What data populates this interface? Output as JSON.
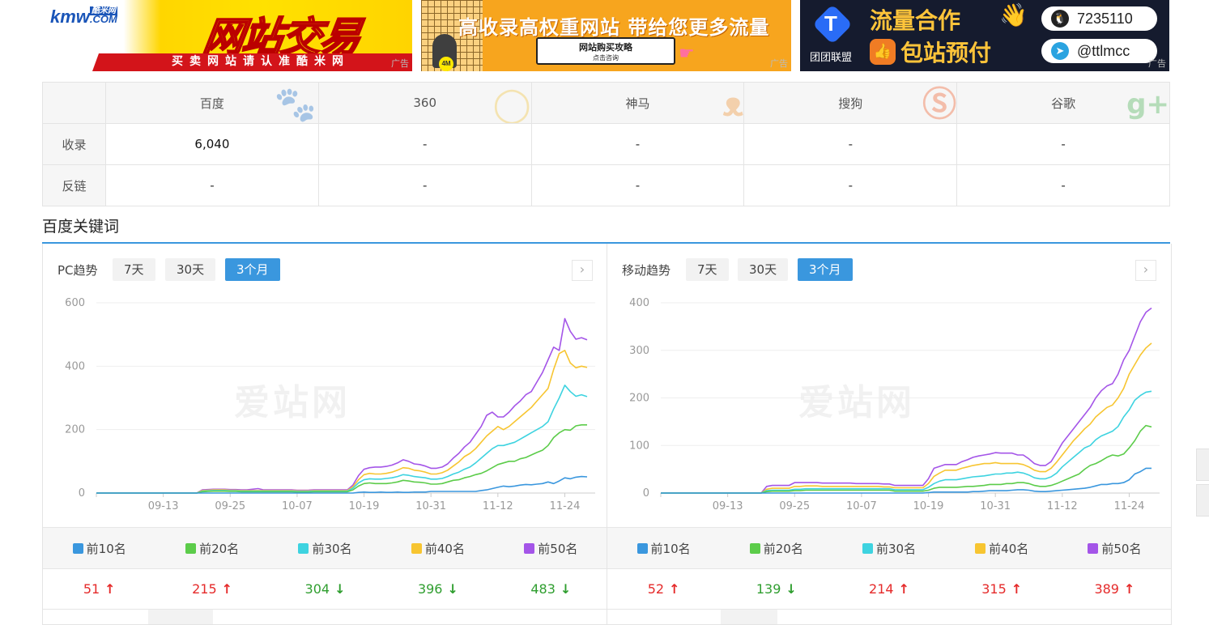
{
  "ads": [
    {
      "logo_main": "kmw",
      "logo_badge": "酷米网",
      "logo_com": ".COM",
      "headline": "网站交易",
      "strip": "买卖网站请认准酷米网",
      "tag": "广告"
    },
    {
      "headline": "高收录高权重网站  带给您更多流量",
      "bubble_line1": "网站购买攻略",
      "bubble_line2": "点击咨询",
      "ball": "4M",
      "tag": "广告"
    },
    {
      "brand": "团团联盟",
      "line1": "流量合作",
      "line2": "包站预付",
      "contact1": "7235110",
      "contact2": "@ttlmcc",
      "tag": "广告"
    }
  ],
  "stats": {
    "engines": [
      {
        "name": "百度",
        "icon": "baidu-paw-icon",
        "color": "#3a7ee8"
      },
      {
        "name": "360",
        "icon": "360-icon",
        "color": "#f1c232"
      },
      {
        "name": "神马",
        "icon": "shenma-icon",
        "color": "#f08a24"
      },
      {
        "name": "搜狗",
        "icon": "sogou-icon",
        "color": "#f0541e"
      },
      {
        "name": "谷歌",
        "icon": "google-plus-icon",
        "color": "#3fae49"
      }
    ],
    "rows": [
      {
        "label": "收录",
        "values": [
          "6,040",
          "-",
          "-",
          "-",
          "-"
        ]
      },
      {
        "label": "反链",
        "values": [
          "-",
          "-",
          "-",
          "-",
          "-"
        ]
      }
    ]
  },
  "section_title": "百度关键词",
  "series_names": [
    "前10名",
    "前20名",
    "前30名",
    "前40名",
    "前50名"
  ],
  "series_colors": [
    "#3a97de",
    "#5ccc4a",
    "#3ed3e0",
    "#f7c531",
    "#a455e8"
  ],
  "panels": {
    "pc": {
      "title": "PC趋势",
      "ranges": [
        "7天",
        "30天",
        "3个月"
      ],
      "active_range": "3个月",
      "next": "›",
      "values": [
        {
          "value": "51",
          "trend": "up"
        },
        {
          "value": "215",
          "trend": "up"
        },
        {
          "value": "304",
          "trend": "down"
        },
        {
          "value": "396",
          "trend": "down"
        },
        {
          "value": "483",
          "trend": "down"
        }
      ]
    },
    "mobile": {
      "title": "移动趋势",
      "ranges": [
        "7天",
        "30天",
        "3个月"
      ],
      "active_range": "3个月",
      "next": "›",
      "values": [
        {
          "value": "52",
          "trend": "up"
        },
        {
          "value": "139",
          "trend": "down"
        },
        {
          "value": "214",
          "trend": "up"
        },
        {
          "value": "315",
          "trend": "up"
        },
        {
          "value": "389",
          "trend": "up"
        }
      ]
    }
  },
  "watermark": "爱站网",
  "chart_data": [
    {
      "type": "line",
      "title": "PC趋势",
      "x_ticks": [
        "09-13",
        "09-25",
        "10-07",
        "10-19",
        "10-31",
        "11-12",
        "11-24"
      ],
      "y_ticks": [
        0,
        200,
        400,
        600
      ],
      "ylim": [
        0,
        600
      ],
      "x_index_ticks": [
        12,
        24,
        36,
        48,
        60,
        72,
        84
      ],
      "n_points": 89,
      "series": [
        {
          "name": "前10名",
          "values": [
            0,
            0,
            0,
            0,
            0,
            0,
            0,
            0,
            0,
            0,
            0,
            0,
            0,
            0,
            0,
            0,
            0,
            0,
            0,
            0,
            0,
            0,
            0,
            0,
            0,
            0,
            0,
            0,
            0,
            0,
            0,
            0,
            0,
            0,
            0,
            0,
            0,
            0,
            0,
            0,
            0,
            0,
            0,
            0,
            0,
            0,
            0,
            2,
            3,
            2,
            2,
            3,
            2,
            2,
            3,
            2,
            2,
            3,
            3,
            3,
            5,
            5,
            5,
            5,
            5,
            5,
            5,
            5,
            5,
            8,
            10,
            14,
            18,
            22,
            20,
            22,
            25,
            27,
            26,
            28,
            30,
            35,
            30,
            38,
            48,
            45,
            50,
            52,
            51
          ]
        },
        {
          "name": "前20名",
          "values": [
            0,
            0,
            0,
            0,
            0,
            0,
            0,
            0,
            0,
            0,
            0,
            0,
            0,
            0,
            0,
            0,
            0,
            0,
            0,
            4,
            5,
            6,
            6,
            6,
            5,
            5,
            4,
            4,
            4,
            4,
            4,
            4,
            4,
            4,
            4,
            4,
            3,
            3,
            3,
            4,
            4,
            4,
            4,
            4,
            4,
            4,
            10,
            22,
            30,
            32,
            30,
            30,
            30,
            32,
            35,
            40,
            38,
            35,
            34,
            32,
            28,
            28,
            30,
            35,
            40,
            42,
            48,
            52,
            58,
            62,
            70,
            80,
            90,
            95,
            100,
            100,
            108,
            112,
            120,
            128,
            135,
            150,
            175,
            190,
            200,
            198,
            212,
            215,
            215
          ]
        },
        {
          "name": "前30名",
          "values": [
            0,
            0,
            0,
            0,
            0,
            0,
            0,
            0,
            0,
            0,
            0,
            0,
            0,
            0,
            0,
            0,
            0,
            0,
            0,
            6,
            7,
            8,
            8,
            8,
            7,
            7,
            6,
            6,
            6,
            6,
            6,
            6,
            6,
            6,
            6,
            6,
            5,
            5,
            5,
            6,
            6,
            6,
            6,
            6,
            6,
            6,
            15,
            32,
            42,
            45,
            44,
            44,
            46,
            48,
            52,
            58,
            56,
            52,
            50,
            48,
            44,
            44,
            46,
            52,
            60,
            66,
            75,
            82,
            95,
            110,
            125,
            140,
            150,
            150,
            155,
            160,
            170,
            180,
            190,
            200,
            210,
            225,
            265,
            300,
            340,
            320,
            305,
            310,
            304
          ]
        },
        {
          "name": "前40名",
          "values": [
            0,
            0,
            0,
            0,
            0,
            0,
            0,
            0,
            0,
            0,
            0,
            0,
            0,
            0,
            0,
            0,
            0,
            0,
            0,
            8,
            9,
            10,
            10,
            10,
            9,
            9,
            8,
            8,
            8,
            8,
            8,
            8,
            8,
            8,
            8,
            8,
            7,
            7,
            7,
            8,
            8,
            8,
            8,
            8,
            8,
            8,
            20,
            42,
            58,
            62,
            60,
            60,
            62,
            66,
            72,
            80,
            78,
            72,
            70,
            66,
            60,
            60,
            64,
            72,
            85,
            98,
            115,
            125,
            140,
            160,
            180,
            195,
            210,
            200,
            210,
            225,
            240,
            255,
            270,
            290,
            310,
            330,
            390,
            440,
            450,
            410,
            395,
            400,
            396
          ]
        },
        {
          "name": "前50名",
          "values": [
            0,
            0,
            0,
            0,
            0,
            0,
            0,
            0,
            0,
            0,
            0,
            0,
            0,
            0,
            0,
            0,
            0,
            0,
            0,
            10,
            11,
            12,
            12,
            12,
            11,
            11,
            10,
            10,
            12,
            14,
            10,
            10,
            10,
            10,
            10,
            10,
            9,
            9,
            9,
            10,
            10,
            10,
            10,
            10,
            10,
            10,
            25,
            55,
            75,
            80,
            82,
            82,
            84,
            88,
            95,
            105,
            100,
            92,
            90,
            85,
            78,
            78,
            82,
            92,
            110,
            125,
            145,
            160,
            185,
            210,
            245,
            255,
            240,
            240,
            255,
            275,
            290,
            310,
            320,
            350,
            380,
            420,
            460,
            450,
            550,
            510,
            485,
            490,
            483
          ]
        }
      ]
    },
    {
      "type": "line",
      "title": "移动趋势",
      "x_ticks": [
        "09-13",
        "09-25",
        "10-07",
        "10-19",
        "10-31",
        "11-12",
        "11-24"
      ],
      "y_ticks": [
        0,
        100,
        200,
        300,
        400
      ],
      "ylim": [
        0,
        400
      ],
      "x_index_ticks": [
        12,
        24,
        36,
        48,
        60,
        72,
        84
      ],
      "n_points": 89,
      "series": [
        {
          "name": "前10名",
          "values": [
            0,
            0,
            0,
            0,
            0,
            0,
            0,
            0,
            0,
            0,
            0,
            0,
            0,
            0,
            0,
            0,
            0,
            0,
            0,
            0,
            0,
            0,
            0,
            0,
            0,
            0,
            0,
            0,
            0,
            0,
            0,
            0,
            0,
            0,
            0,
            0,
            0,
            0,
            0,
            0,
            0,
            0,
            0,
            0,
            0,
            0,
            0,
            0,
            1,
            2,
            2,
            2,
            2,
            2,
            2,
            2,
            3,
            3,
            4,
            5,
            5,
            5,
            5,
            6,
            7,
            7,
            6,
            4,
            3,
            3,
            4,
            5,
            6,
            7,
            8,
            9,
            10,
            12,
            15,
            18,
            18,
            20,
            20,
            22,
            28,
            40,
            45,
            52,
            52
          ]
        },
        {
          "name": "前20名",
          "values": [
            0,
            0,
            0,
            0,
            0,
            0,
            0,
            0,
            0,
            0,
            0,
            0,
            0,
            0,
            0,
            0,
            0,
            0,
            0,
            3,
            4,
            4,
            4,
            4,
            5,
            5,
            6,
            6,
            6,
            6,
            6,
            6,
            6,
            6,
            6,
            6,
            6,
            6,
            6,
            6,
            6,
            6,
            4,
            4,
            4,
            4,
            4,
            4,
            6,
            10,
            12,
            12,
            12,
            12,
            13,
            14,
            14,
            15,
            16,
            18,
            18,
            18,
            20,
            20,
            22,
            22,
            20,
            16,
            14,
            14,
            16,
            20,
            25,
            30,
            35,
            40,
            50,
            58,
            62,
            68,
            75,
            80,
            78,
            82,
            95,
            110,
            130,
            142,
            139
          ]
        },
        {
          "name": "前30名",
          "values": [
            0,
            0,
            0,
            0,
            0,
            0,
            0,
            0,
            0,
            0,
            0,
            0,
            0,
            0,
            0,
            0,
            0,
            0,
            0,
            5,
            6,
            6,
            6,
            6,
            8,
            8,
            9,
            9,
            9,
            9,
            9,
            9,
            9,
            9,
            9,
            9,
            9,
            9,
            9,
            9,
            9,
            9,
            7,
            7,
            7,
            7,
            7,
            7,
            12,
            20,
            25,
            28,
            28,
            28,
            30,
            32,
            34,
            35,
            36,
            38,
            40,
            40,
            42,
            42,
            44,
            42,
            38,
            32,
            30,
            30,
            34,
            42,
            55,
            65,
            75,
            85,
            95,
            100,
            112,
            120,
            125,
            130,
            140,
            160,
            175,
            195,
            205,
            212,
            214
          ]
        },
        {
          "name": "前40名",
          "values": [
            0,
            0,
            0,
            0,
            0,
            0,
            0,
            0,
            0,
            0,
            0,
            0,
            0,
            0,
            0,
            0,
            0,
            0,
            0,
            8,
            10,
            10,
            10,
            10,
            14,
            14,
            15,
            15,
            15,
            14,
            14,
            14,
            14,
            14,
            14,
            14,
            14,
            14,
            14,
            14,
            13,
            13,
            11,
            11,
            11,
            11,
            11,
            11,
            20,
            35,
            42,
            48,
            48,
            48,
            52,
            55,
            58,
            60,
            62,
            62,
            64,
            62,
            62,
            62,
            62,
            60,
            55,
            48,
            45,
            45,
            52,
            65,
            80,
            95,
            110,
            122,
            135,
            145,
            160,
            170,
            180,
            185,
            200,
            220,
            250,
            270,
            290,
            305,
            315
          ]
        },
        {
          "name": "前50名",
          "values": [
            0,
            0,
            0,
            0,
            0,
            0,
            0,
            0,
            0,
            0,
            0,
            0,
            0,
            0,
            0,
            0,
            0,
            0,
            0,
            14,
            16,
            16,
            16,
            16,
            22,
            22,
            22,
            22,
            22,
            21,
            21,
            21,
            21,
            21,
            21,
            20,
            20,
            20,
            20,
            20,
            19,
            19,
            16,
            16,
            16,
            16,
            16,
            16,
            30,
            52,
            56,
            60,
            60,
            60,
            66,
            70,
            75,
            78,
            80,
            82,
            85,
            84,
            84,
            84,
            80,
            80,
            72,
            62,
            58,
            58,
            66,
            85,
            105,
            120,
            135,
            150,
            165,
            180,
            200,
            215,
            225,
            230,
            250,
            280,
            300,
            330,
            360,
            380,
            389
          ]
        }
      ]
    }
  ]
}
